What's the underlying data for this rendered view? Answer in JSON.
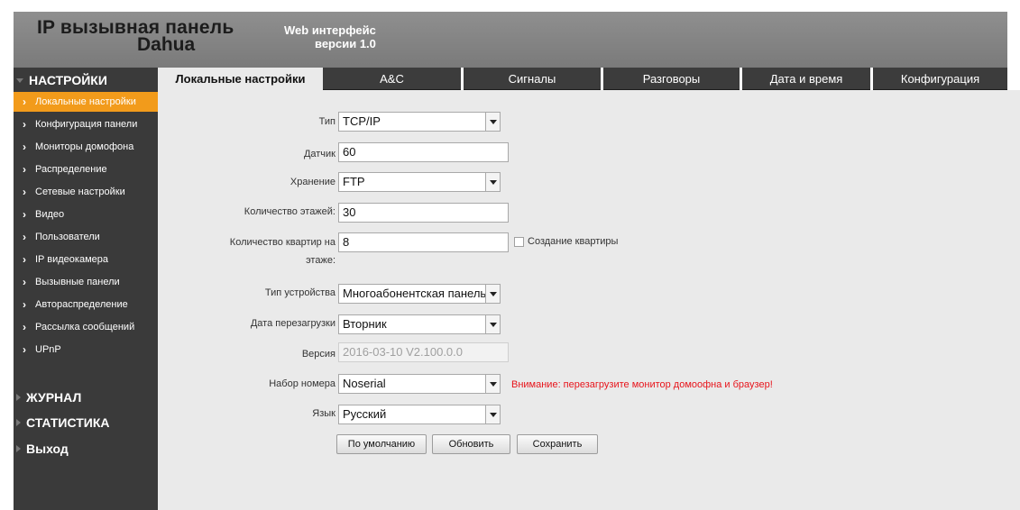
{
  "header": {
    "title_line1": "IP вызывная панель",
    "title_line2": "Dahua",
    "subtitle_line1": "Web интерфейс",
    "subtitle_line2": "версии 1.0"
  },
  "sidebar": {
    "sections": [
      {
        "label": "НАСТРОЙКИ",
        "expanded": true
      },
      {
        "label": "ЖУРНАЛ",
        "expanded": false
      },
      {
        "label": "СТАТИСТИКА",
        "expanded": false
      },
      {
        "label": "Выход",
        "expanded": false
      }
    ],
    "items": [
      {
        "label": "Локальные настройки",
        "active": true
      },
      {
        "label": "Конфигурация панели"
      },
      {
        "label": "Мониторы домофона"
      },
      {
        "label": "Распределение"
      },
      {
        "label": "Сетевые настройки"
      },
      {
        "label": "Видео"
      },
      {
        "label": "Пользователи"
      },
      {
        "label": "IP видеокамера"
      },
      {
        "label": "Вызывные панели"
      },
      {
        "label": "Автораспределение"
      },
      {
        "label": "Рассылка сообщений"
      },
      {
        "label": "UPnP"
      }
    ]
  },
  "tabs": [
    {
      "label": "Локальные настройки",
      "active": true
    },
    {
      "label": "A&C"
    },
    {
      "label": "Сигналы"
    },
    {
      "label": "Разговоры"
    },
    {
      "label": "Дата и время"
    },
    {
      "label": "Конфигурация"
    }
  ],
  "form": {
    "type_label": "Тип",
    "type_value": "TCP/IP",
    "sensor_label": "Датчик",
    "sensor_value": "60",
    "storage_label": "Хранение",
    "storage_value": "FTP",
    "floors_label": "Количество этажей:",
    "floors_value": "30",
    "apts_label_line1": "Количество квартир на",
    "apts_label_line2": "этаже:",
    "apts_value": "8",
    "create_apt_label": "Создание квартиры",
    "device_type_label": "Тип устройства",
    "device_type_value": "Многоабонентская панель",
    "reboot_label": "Дата перезагрузки",
    "reboot_value": "Вторник",
    "version_label": "Версия",
    "version_value": "2016-03-10 V2.100.0.0",
    "dial_label": "Набор номера",
    "dial_value": "Noserial",
    "warning": "Внимание: перезагрузите монитор домоофна и браузер!",
    "lang_label": "Язык",
    "lang_value": "Русский"
  },
  "buttons": {
    "default": "По умолчанию",
    "refresh": "Обновить",
    "save": "Сохранить"
  }
}
